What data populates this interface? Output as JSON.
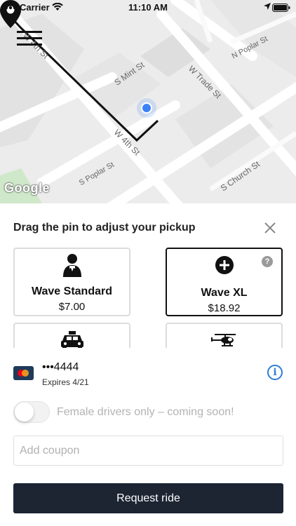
{
  "status_bar": {
    "carrier": "Carrier",
    "time": "11:10 AM"
  },
  "map": {
    "streets": [
      "W 4th St",
      "S Mint St",
      "W Trade St",
      "N Poplar St",
      "S Poplar St",
      "S Church St",
      "W 4th St"
    ],
    "attribution": "Google"
  },
  "sheet": {
    "title": "Drag the pin to adjust your pickup",
    "options": [
      {
        "name": "Wave Standard",
        "price": "$7.00",
        "icon": "chauffeur-icon",
        "selected": false
      },
      {
        "name": "Wave XL",
        "price": "$18.92",
        "icon": "plus-icon",
        "selected": true
      },
      {
        "name": "",
        "price": "",
        "icon": "taxi-icon",
        "selected": false
      },
      {
        "name": "",
        "price": "",
        "icon": "helicopter-icon",
        "selected": false
      }
    ],
    "payment": {
      "card_number": "•••4444",
      "expires": "Expires 4/21"
    },
    "female_drivers_label": "Female drivers only – coming soon!",
    "coupon_placeholder": "Add coupon",
    "request_button": "Request ride"
  },
  "colors": {
    "primary_button": "#1d2533",
    "info_accent": "#2a7fd4",
    "location_dot": "#3b82f6"
  }
}
